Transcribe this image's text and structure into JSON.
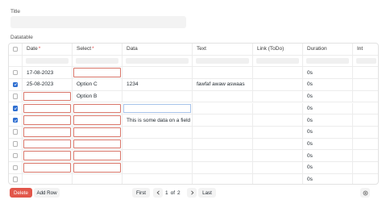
{
  "form": {
    "title_label": "Title",
    "datatable_label": "Datatable"
  },
  "table": {
    "headers": [
      "Date",
      "Select",
      "Data",
      "Text",
      "Link (ToDo)",
      "Duration",
      "Int"
    ],
    "required": [
      true,
      true,
      false,
      false,
      false,
      false,
      false
    ],
    "rows": [
      {
        "checked": false,
        "date": "17-08-2023",
        "select": "",
        "data": "",
        "text": "",
        "link": "",
        "duration": "0s",
        "int": "",
        "date_err": false,
        "select_err": true,
        "data_focus": false
      },
      {
        "checked": true,
        "date": "25-08-2023",
        "select": "Option C",
        "data": "1234",
        "text": "fawfaf awaw aswaas",
        "link": "",
        "duration": "0s",
        "int": "",
        "date_err": false,
        "select_err": false,
        "data_focus": false
      },
      {
        "checked": false,
        "date": "",
        "select": "Option B",
        "data": "",
        "text": "",
        "link": "",
        "duration": "0s",
        "int": "",
        "date_err": true,
        "select_err": false,
        "data_focus": false
      },
      {
        "checked": true,
        "date": "",
        "select": "",
        "data": "",
        "text": "",
        "link": "",
        "duration": "0s",
        "int": "",
        "date_err": true,
        "select_err": true,
        "data_focus": true
      },
      {
        "checked": true,
        "date": "",
        "select": "",
        "data": "This is some data on a field",
        "text": "",
        "link": "",
        "duration": "0s",
        "int": "",
        "date_err": true,
        "select_err": true,
        "data_focus": false
      },
      {
        "checked": false,
        "date": "",
        "select": "",
        "data": "",
        "text": "",
        "link": "",
        "duration": "0s",
        "int": "",
        "date_err": true,
        "select_err": true,
        "data_focus": false
      },
      {
        "checked": false,
        "date": "",
        "select": "",
        "data": "",
        "text": "",
        "link": "",
        "duration": "0s",
        "int": "",
        "date_err": true,
        "select_err": true,
        "data_focus": false
      },
      {
        "checked": false,
        "date": "",
        "select": "",
        "data": "",
        "text": "",
        "link": "",
        "duration": "0s",
        "int": "",
        "date_err": true,
        "select_err": true,
        "data_focus": false
      },
      {
        "checked": false,
        "date": "",
        "select": "",
        "data": "",
        "text": "",
        "link": "",
        "duration": "0s",
        "int": "",
        "date_err": true,
        "select_err": true,
        "data_focus": false
      },
      {
        "checked": false,
        "date": "",
        "select": "",
        "data": "",
        "text": "",
        "link": "",
        "duration": "0s",
        "int": "",
        "date_err": false,
        "select_err": false,
        "data_focus": false
      }
    ]
  },
  "footer": {
    "delete_label": "Delete",
    "add_row_label": "Add Row",
    "first_label": "First",
    "prev_icon": "chevron-left-icon",
    "page_current": "1",
    "page_of": "of",
    "page_total": "2",
    "next_icon": "chevron-right-icon",
    "last_label": "Last",
    "settings_icon": "gear-icon"
  },
  "colors": {
    "checkbox_checked": "#2f6fd1",
    "error_border": "#d9776b",
    "delete_button": "#e2564a",
    "required_star": "#e24c4c"
  }
}
